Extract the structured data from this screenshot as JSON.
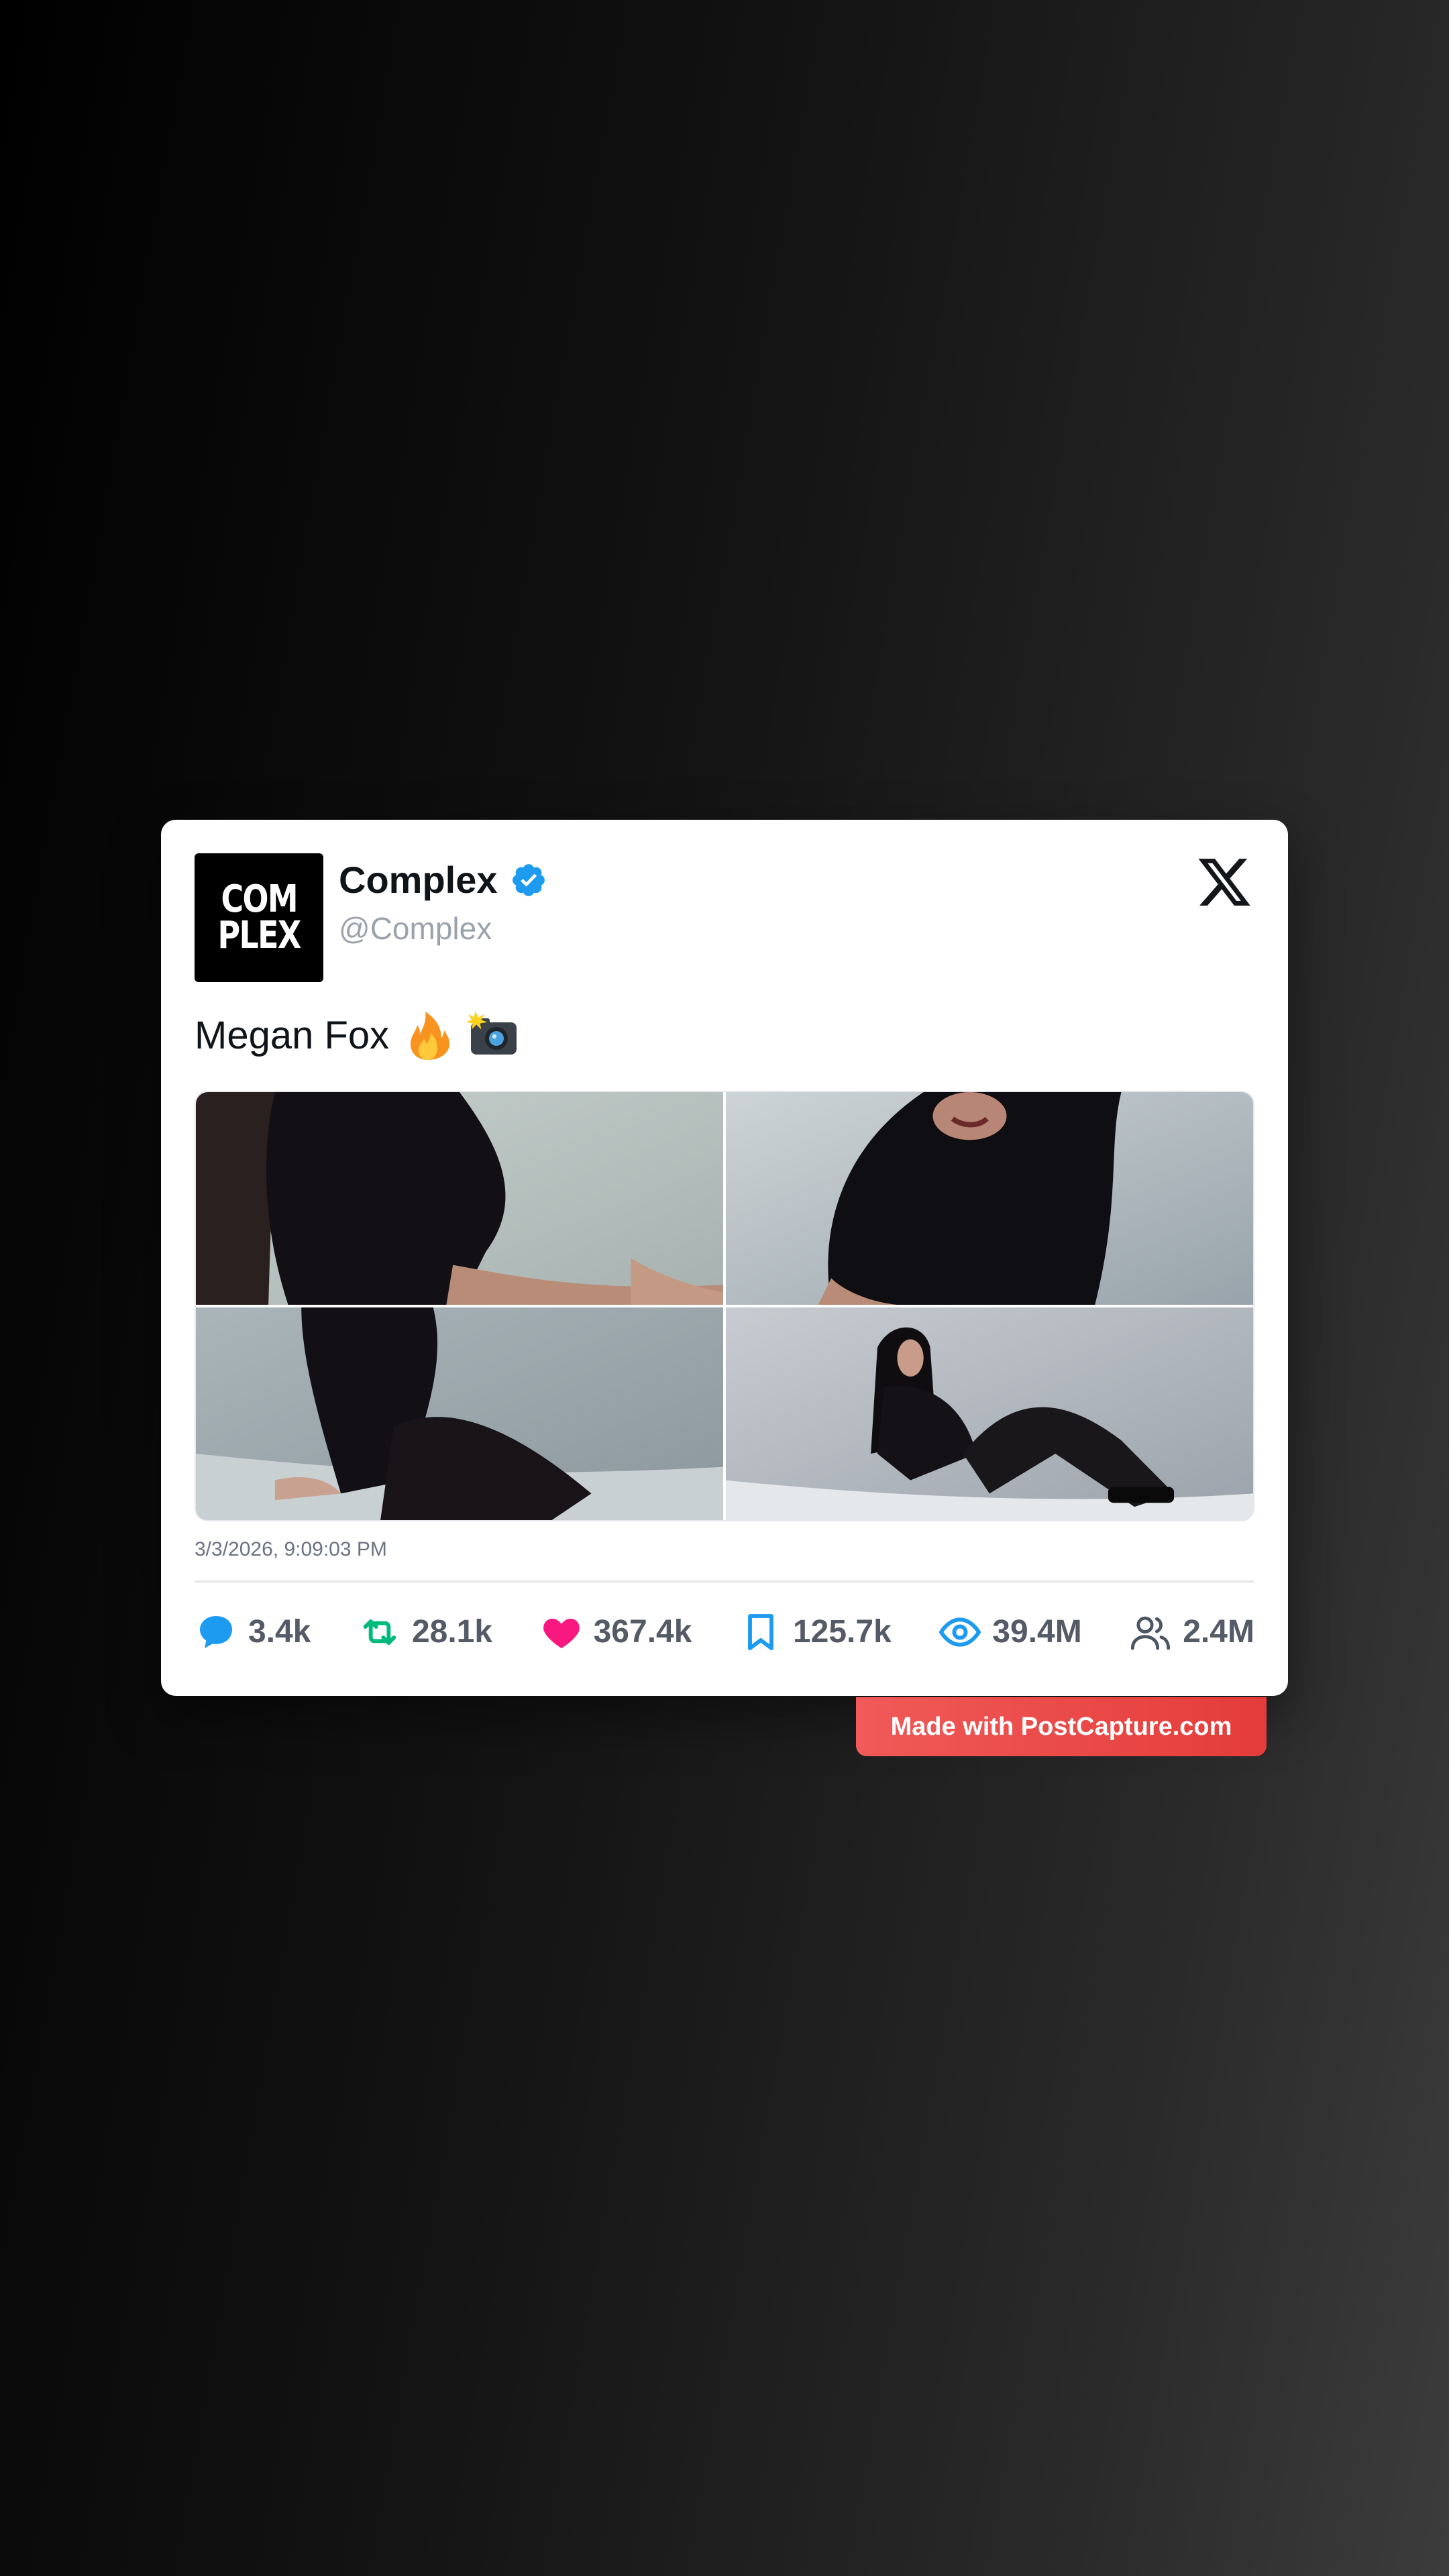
{
  "post": {
    "avatar_text": [
      "COM",
      "PLEX"
    ],
    "display_name": "Complex",
    "handle": "@Complex",
    "verified": true,
    "text": "Megan Fox",
    "emojis": [
      "fire-emoji",
      "camera-flash-emoji"
    ],
    "media_count": 4,
    "timestamp": "3/3/2026, 9:09:03 PM"
  },
  "stats": {
    "replies": "3.4k",
    "reposts": "28.1k",
    "likes": "367.4k",
    "bookmarks": "125.7k",
    "views": "39.4M",
    "followers": "2.4M"
  },
  "colors": {
    "verified": "#1d9bf0",
    "reply": "#1d9bf0",
    "repost": "#00ba7c",
    "like": "#f91880",
    "bookmark": "#1d9bf0",
    "views": "#1d9bf0",
    "followers": "#4b5563",
    "watermark": "#e8423f"
  },
  "watermark": {
    "label": "Made with PostCapture.com"
  }
}
